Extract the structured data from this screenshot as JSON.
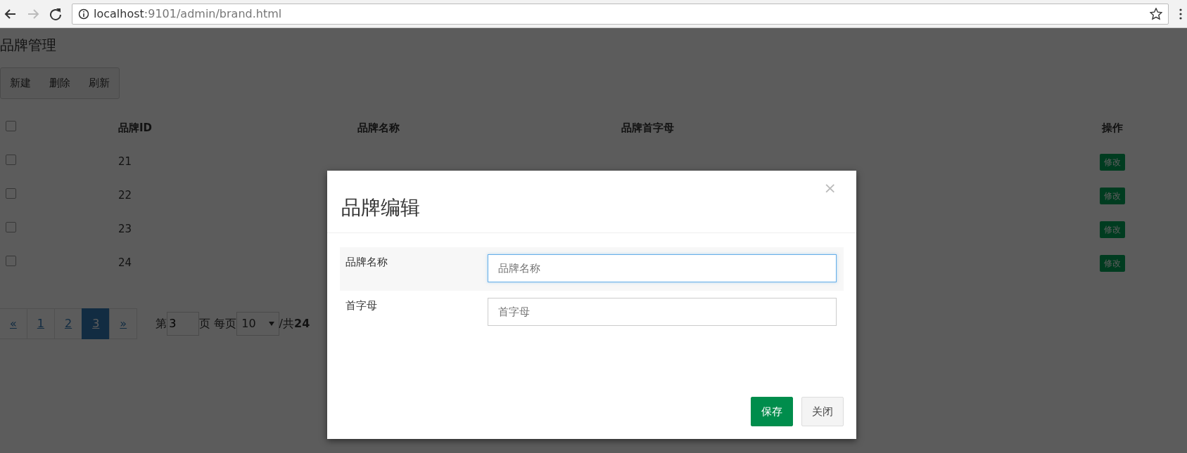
{
  "browser": {
    "host": "localhost",
    "path": ":9101/admin/brand.html"
  },
  "page": {
    "title": "品牌管理",
    "toolbar": [
      "新建",
      "删除",
      "刷新"
    ],
    "table": {
      "select_all_checked": false,
      "columns": [
        "品牌ID",
        "品牌名称",
        "品牌首字母",
        "操作"
      ],
      "rows": [
        {
          "checked": false,
          "id": "21",
          "action": "修改"
        },
        {
          "checked": false,
          "id": "22",
          "action": "修改"
        },
        {
          "checked": false,
          "id": "23",
          "action": "修改"
        },
        {
          "checked": false,
          "id": "24",
          "action": "修改"
        }
      ]
    },
    "pagination": {
      "prev": "«",
      "next": "»",
      "pages": [
        {
          "label": "1",
          "selected": false
        },
        {
          "label": "2",
          "selected": false
        },
        {
          "label": "3",
          "selected": true
        }
      ],
      "page_prefix": "第",
      "page_value": "3",
      "page_suffix": "页 每页",
      "per_page": "10",
      "total_prefix": "/共",
      "total": "24"
    }
  },
  "modal": {
    "title": "品牌编辑",
    "close": "×",
    "fields": [
      {
        "label": "品牌名称",
        "placeholder": "品牌名称",
        "focused": true
      },
      {
        "label": "首字母",
        "placeholder": "首字母",
        "focused": false
      }
    ],
    "buttons": [
      {
        "label": "保存",
        "kind": "primary"
      },
      {
        "label": "关闭",
        "kind": "default"
      }
    ]
  }
}
